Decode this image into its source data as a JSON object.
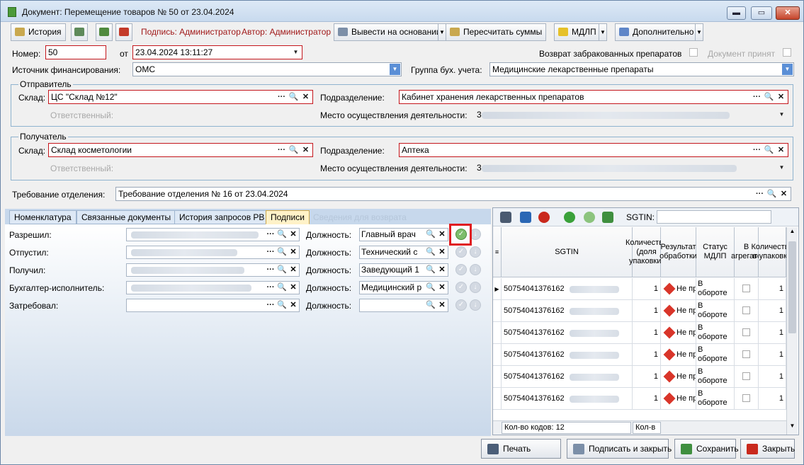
{
  "window": {
    "title": "Документ: Перемещение товаров № 50 от 23.04.2024",
    "controls": {
      "minimize": "▬",
      "maximize": "▭",
      "close": "✕"
    }
  },
  "toolbar": {
    "history_label": "История",
    "signature_label": "Подпись: Администратор",
    "author_label": "Автор: Администратор",
    "derive_label": "Вывести на основании",
    "recalc_label": "Пересчитать суммы",
    "mdlp_label": "МДЛП",
    "extra_label": "Дополнительно",
    "dropdown_glyph": "▼"
  },
  "header": {
    "number_label": "Номер:",
    "number_value": "50",
    "from_label": "от",
    "date_value": "23.04.2024 13:11:27",
    "return_label": "Возврат забракованных препаратов",
    "accepted_label": "Документ принят",
    "funding_label": "Источник финансирования:",
    "funding_value": "ОМС",
    "accounting_group_label": "Группа бух. учета:",
    "accounting_group_value": "Медицинские лекарственные препараты"
  },
  "sender": {
    "group_title": "Отправитель",
    "warehouse_label": "Склад:",
    "warehouse_value": "ЦС \"Склад №12\"",
    "department_label": "Подразделение:",
    "department_value": "Кабинет хранения лекарственных препаратов",
    "responsible_label": "Ответственный:",
    "place_label": "Место осуществления деятельности:",
    "place_value_visible": "3"
  },
  "receiver": {
    "group_title": "Получатель",
    "warehouse_label": "Склад:",
    "warehouse_value": "Склад косметологии",
    "department_label": "Подразделение:",
    "department_value": "Аптека",
    "responsible_label": "Ответственный:",
    "place_label": "Место осуществления деятельности:",
    "place_value_visible": "3"
  },
  "requirement": {
    "label": "Требование отделения:",
    "value": "Требование отделения № 16 от 23.04.2024"
  },
  "field_buttons": {
    "more": "···",
    "search": "🔍",
    "clear": "✕"
  },
  "tabs": [
    {
      "label": "Номенклатура"
    },
    {
      "label": "Связанные документы"
    },
    {
      "label": "История запросов РВ"
    },
    {
      "label": "Подписи"
    },
    {
      "label": "Сведения для возврата"
    }
  ],
  "signatures": {
    "position_label": "Должность:",
    "rows": [
      {
        "label": "Разрешил:",
        "position": "Главный врач"
      },
      {
        "label": "Отпустил:",
        "position": "Технический с"
      },
      {
        "label": "Получил:",
        "position": "Заведующий 1"
      },
      {
        "label": "Бухгалтер-исполнитель:",
        "position": "Медицинский р"
      },
      {
        "label": "Затребовал:",
        "position": ""
      }
    ]
  },
  "sgtin_panel": {
    "search_label": "SGTIN:",
    "search_value": "",
    "columns": [
      {
        "label": "SGTIN"
      },
      {
        "label": "Количество (доля упаковки)"
      },
      {
        "label": "Результат обработки"
      },
      {
        "label": "Статус МДЛП"
      },
      {
        "label": "В агрегате"
      },
      {
        "label": "Количество в упаковке"
      }
    ],
    "rows": [
      {
        "sgtin": "50754041376162",
        "qty": "1",
        "result": "Не пр",
        "status": "В обороте",
        "in_pack": "1"
      },
      {
        "sgtin": "50754041376162",
        "qty": "1",
        "result": "Не пр",
        "status": "В обороте",
        "in_pack": "1"
      },
      {
        "sgtin": "50754041376162",
        "qty": "1",
        "result": "Не пр",
        "status": "В обороте",
        "in_pack": "1"
      },
      {
        "sgtin": "50754041376162",
        "qty": "1",
        "result": "Не пр",
        "status": "В обороте",
        "in_pack": "1"
      },
      {
        "sgtin": "50754041376162",
        "qty": "1",
        "result": "Не пр",
        "status": "В обороте",
        "in_pack": "1"
      },
      {
        "sgtin": "50754041376162",
        "qty": "1",
        "result": "Не пр",
        "status": "В обороте",
        "in_pack": "1"
      }
    ],
    "codes_count_label": "Кол-во кодов: 12",
    "second_footer_label": "Кол-в"
  },
  "bottom_buttons": {
    "print": "Печать",
    "sign_close": "Подписать и закрыть",
    "save": "Сохранить",
    "close": "Закрыть"
  }
}
